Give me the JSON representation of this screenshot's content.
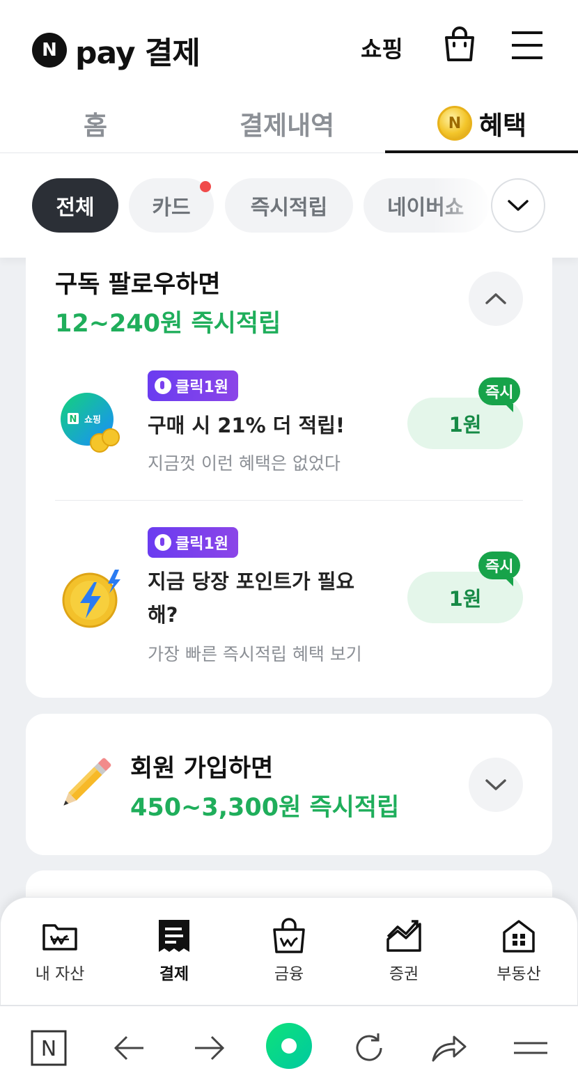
{
  "header": {
    "logo_letter": "N",
    "logo_text": "pay 결제",
    "shopping": "쇼핑"
  },
  "tabs": [
    {
      "label": "홈"
    },
    {
      "label": "결제내역"
    },
    {
      "label": "혜택",
      "coin_letter": "N"
    }
  ],
  "chips": [
    {
      "label": "전체",
      "active": true
    },
    {
      "label": "카드",
      "new_dot": true
    },
    {
      "label": "즉시적립"
    },
    {
      "label": "네이버쇼"
    }
  ],
  "section1": {
    "title": "구독 팔로우하면",
    "subtitle": "12~240원 즉시적립",
    "items": [
      {
        "badge": "클릭1원",
        "title": "구매 시 21% 더 적립!",
        "desc": "지금껏 이런 혜택은 없었다",
        "reward": "1원",
        "tag": "즉시",
        "icon_text": "N 쇼핑"
      },
      {
        "badge": "클릭1원",
        "title_line1": "지금 당장 포인트가 필요",
        "title_line2": "해?",
        "desc": "가장 빠른 즉시적립 혜택 보기",
        "reward": "1원",
        "tag": "즉시"
      }
    ]
  },
  "section2": {
    "title": "회원 가입하면",
    "subtitle": "450~3,300원 즉시적립"
  },
  "bottom_nav": [
    {
      "label": "내 자산"
    },
    {
      "label": "결제",
      "active": true
    },
    {
      "label": "금융"
    },
    {
      "label": "증권"
    },
    {
      "label": "부동산"
    }
  ],
  "browser": {
    "n_letter": "N"
  },
  "colors": {
    "accent_green": "#1fae5b",
    "badge_purple": "#6a3cf0",
    "dark": "#2b2f36"
  }
}
